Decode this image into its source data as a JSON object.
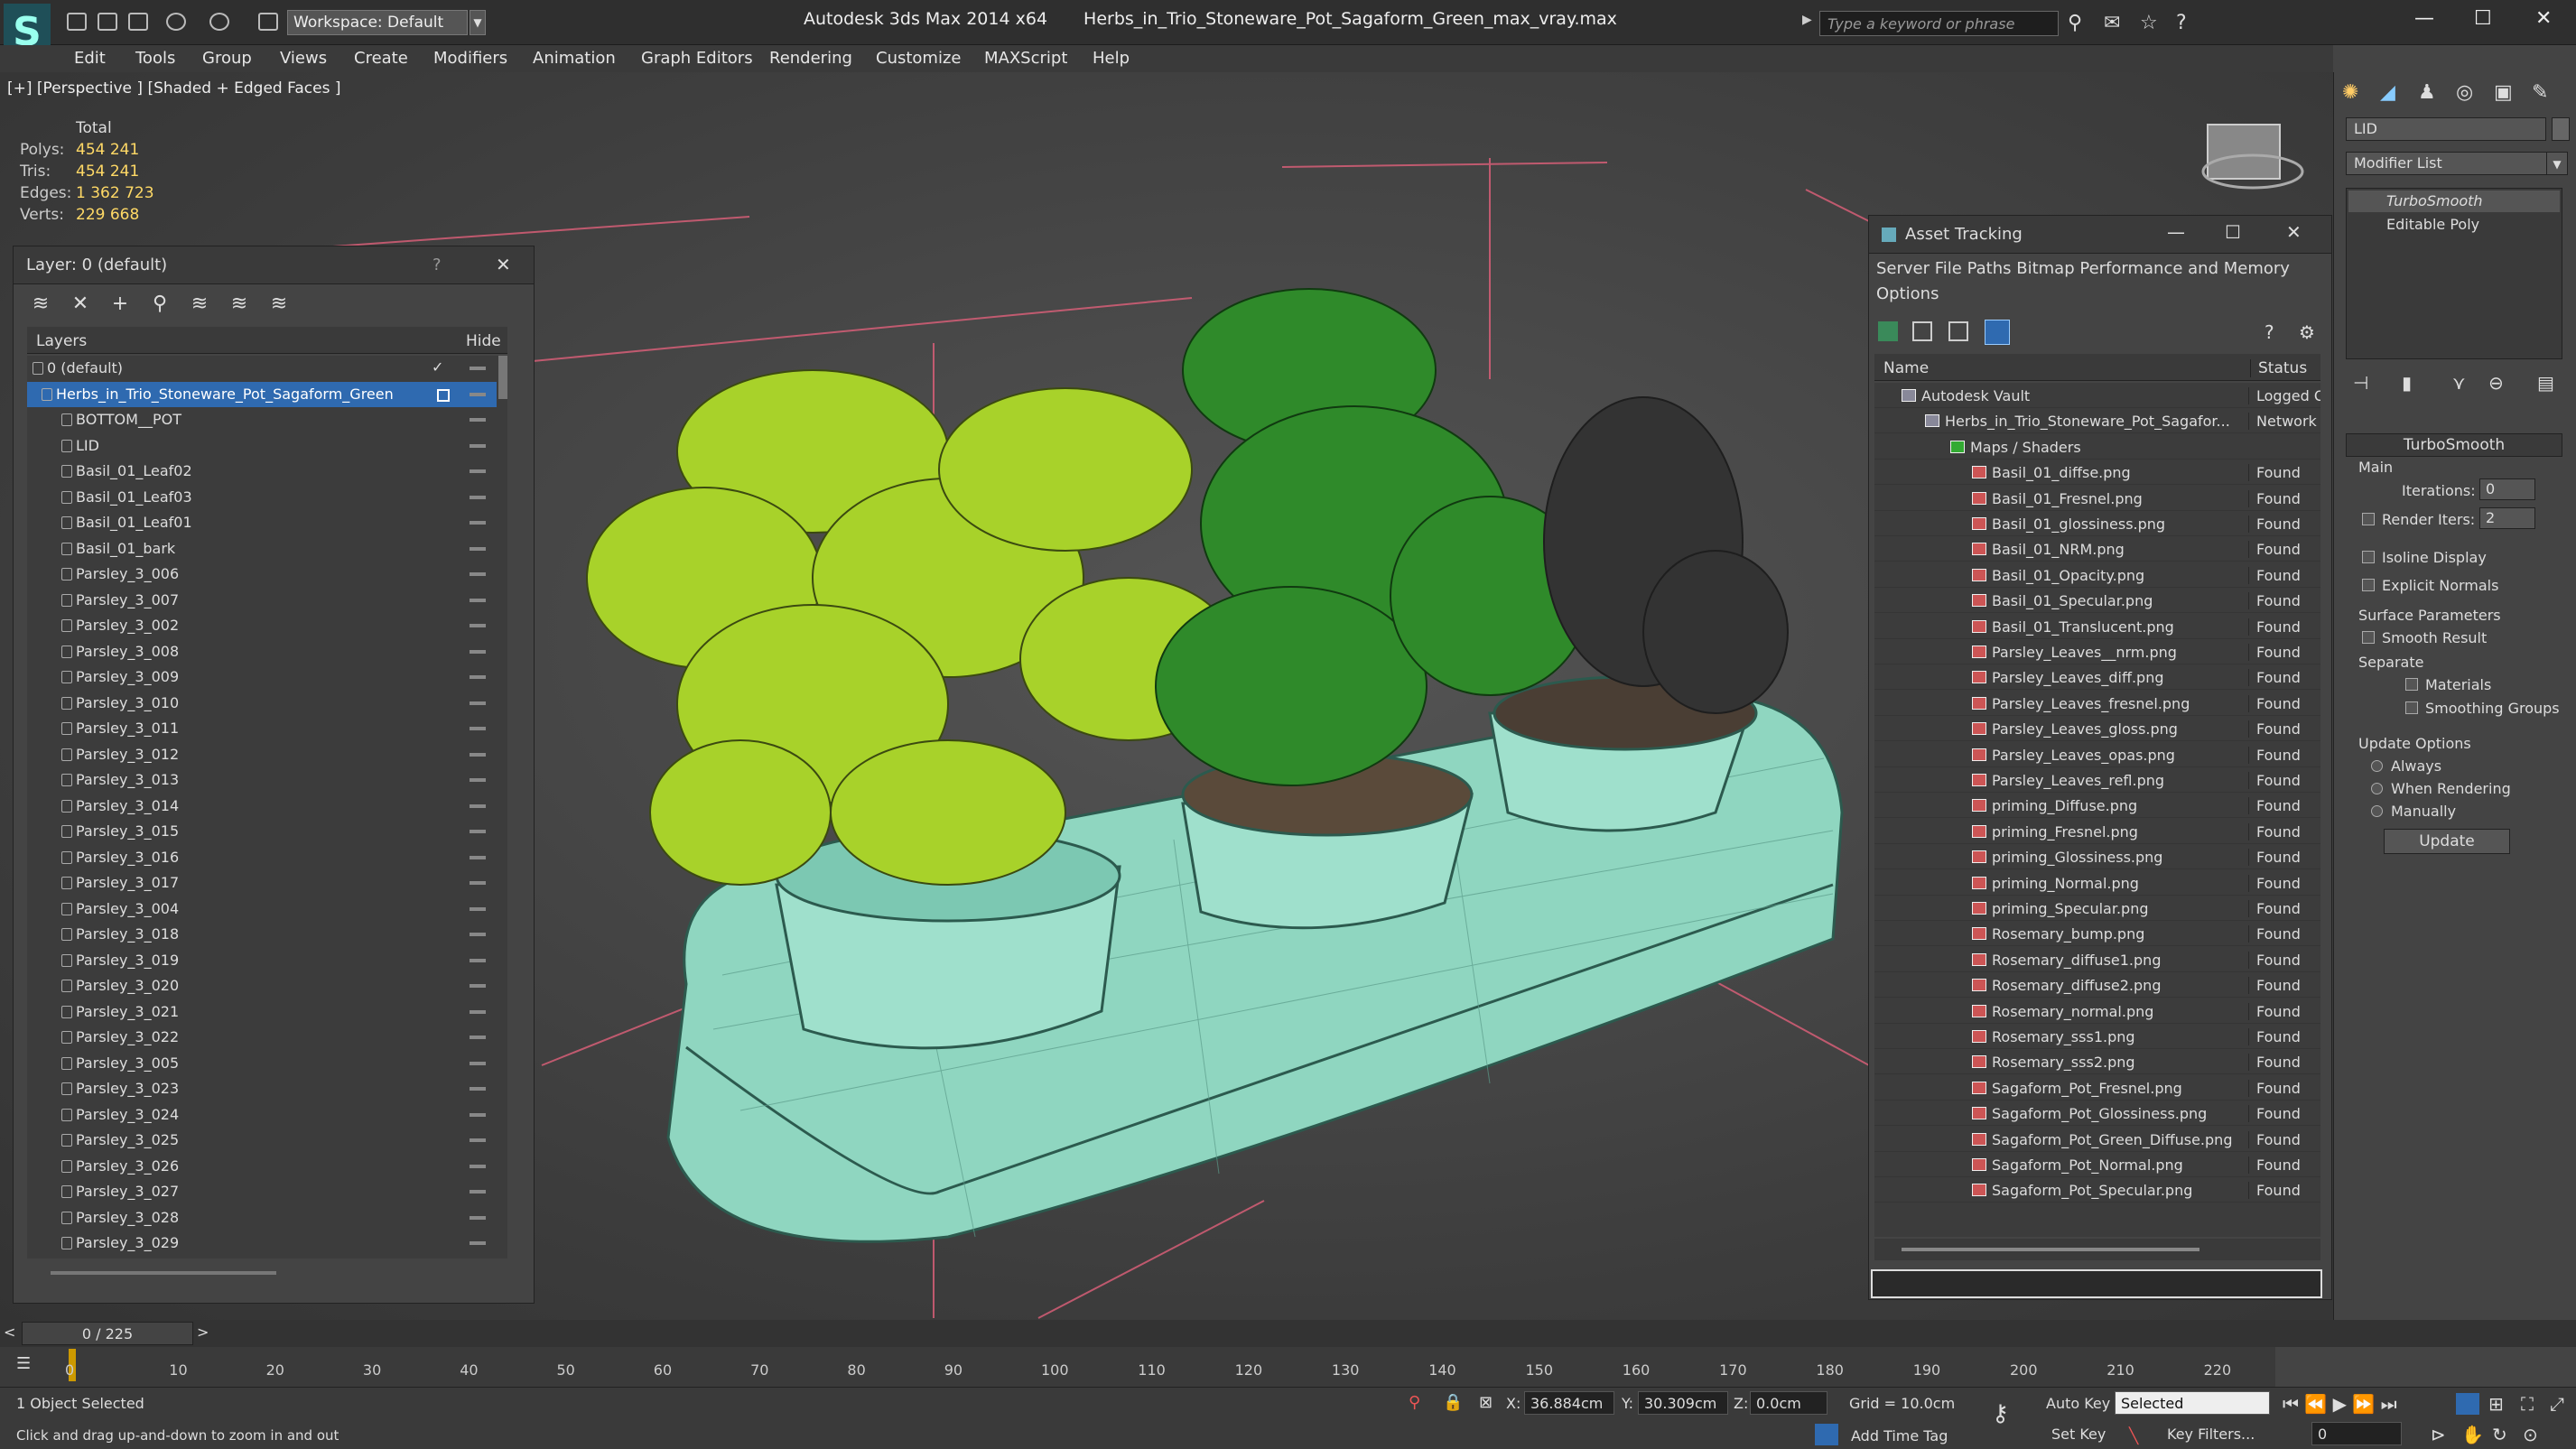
{
  "app": {
    "title": "Autodesk 3ds Max  2014 x64",
    "file": "Herbs_in_Trio_Stoneware_Pot_Sagaform_Green_max_vray.max",
    "workspace": "Workspace: Default",
    "search_placeholder": "Type a keyword or phrase",
    "logo": "S"
  },
  "menu": [
    "Edit",
    "Tools",
    "Group",
    "Views",
    "Create",
    "Modifiers",
    "Animation",
    "Graph Editors",
    "Rendering",
    "Customize",
    "MAXScript",
    "Help"
  ],
  "viewport": {
    "label": "[+] [Perspective ] [Shaded + Edged Faces ]",
    "stats_header": "Total",
    "stats": [
      {
        "k": "Polys:",
        "v": "454 241"
      },
      {
        "k": "Tris:",
        "v": "454 241"
      },
      {
        "k": "Edges:",
        "v": "1 362 723"
      },
      {
        "k": "Verts:",
        "v": "229 668"
      }
    ]
  },
  "layer_window": {
    "title": "Layer: 0 (default)",
    "help": "?",
    "col_layers": "Layers",
    "col_hide": "Hide",
    "rows": [
      "0 (default)",
      "Herbs_in_Trio_Stoneware_Pot_Sagaform_Green",
      "BOTTOM__POT",
      "LID",
      "Basil_01_Leaf02",
      "Basil_01_Leaf03",
      "Basil_01_Leaf01",
      "Basil_01_bark",
      "Parsley_3_006",
      "Parsley_3_007",
      "Parsley_3_002",
      "Parsley_3_008",
      "Parsley_3_009",
      "Parsley_3_010",
      "Parsley_3_011",
      "Parsley_3_012",
      "Parsley_3_013",
      "Parsley_3_014",
      "Parsley_3_015",
      "Parsley_3_016",
      "Parsley_3_017",
      "Parsley_3_004",
      "Parsley_3_018",
      "Parsley_3_019",
      "Parsley_3_020",
      "Parsley_3_021",
      "Parsley_3_022",
      "Parsley_3_005",
      "Parsley_3_023",
      "Parsley_3_024",
      "Parsley_3_025",
      "Parsley_3_026",
      "Parsley_3_027",
      "Parsley_3_028",
      "Parsley_3_029"
    ]
  },
  "asset_window": {
    "title": "Asset Tracking",
    "menu1": "Server   File   Paths   Bitmap Performance and Memory",
    "menu2": "Options",
    "col_name": "Name",
    "col_status": "Status",
    "rows": [
      {
        "name": "Autodesk Vault",
        "status": "Logged O",
        "lvl": 1
      },
      {
        "name": "Herbs_in_Trio_Stoneware_Pot_Sagafor...",
        "status": "Network P",
        "lvl": 2
      },
      {
        "name": "Maps / Shaders",
        "status": "",
        "lvl": 3
      },
      {
        "name": "Basil_01_diffse.png",
        "status": "Found",
        "lvl": 4
      },
      {
        "name": "Basil_01_Fresnel.png",
        "status": "Found",
        "lvl": 4
      },
      {
        "name": "Basil_01_glossiness.png",
        "status": "Found",
        "lvl": 4
      },
      {
        "name": "Basil_01_NRM.png",
        "status": "Found",
        "lvl": 4
      },
      {
        "name": "Basil_01_Opacity.png",
        "status": "Found",
        "lvl": 4
      },
      {
        "name": "Basil_01_Specular.png",
        "status": "Found",
        "lvl": 4
      },
      {
        "name": "Basil_01_Translucent.png",
        "status": "Found",
        "lvl": 4
      },
      {
        "name": "Parsley_Leaves__nrm.png",
        "status": "Found",
        "lvl": 4
      },
      {
        "name": "Parsley_Leaves_diff.png",
        "status": "Found",
        "lvl": 4
      },
      {
        "name": "Parsley_Leaves_fresnel.png",
        "status": "Found",
        "lvl": 4
      },
      {
        "name": "Parsley_Leaves_gloss.png",
        "status": "Found",
        "lvl": 4
      },
      {
        "name": "Parsley_Leaves_opas.png",
        "status": "Found",
        "lvl": 4
      },
      {
        "name": "Parsley_Leaves_refl.png",
        "status": "Found",
        "lvl": 4
      },
      {
        "name": "priming_Diffuse.png",
        "status": "Found",
        "lvl": 4
      },
      {
        "name": "priming_Fresnel.png",
        "status": "Found",
        "lvl": 4
      },
      {
        "name": "priming_Glossiness.png",
        "status": "Found",
        "lvl": 4
      },
      {
        "name": "priming_Normal.png",
        "status": "Found",
        "lvl": 4
      },
      {
        "name": "priming_Specular.png",
        "status": "Found",
        "lvl": 4
      },
      {
        "name": "Rosemary_bump.png",
        "status": "Found",
        "lvl": 4
      },
      {
        "name": "Rosemary_diffuse1.png",
        "status": "Found",
        "lvl": 4
      },
      {
        "name": "Rosemary_diffuse2.png",
        "status": "Found",
        "lvl": 4
      },
      {
        "name": "Rosemary_normal.png",
        "status": "Found",
        "lvl": 4
      },
      {
        "name": "Rosemary_sss1.png",
        "status": "Found",
        "lvl": 4
      },
      {
        "name": "Rosemary_sss2.png",
        "status": "Found",
        "lvl": 4
      },
      {
        "name": "Sagaform_Pot_Fresnel.png",
        "status": "Found",
        "lvl": 4
      },
      {
        "name": "Sagaform_Pot_Glossiness.png",
        "status": "Found",
        "lvl": 4
      },
      {
        "name": "Sagaform_Pot_Green_Diffuse.png",
        "status": "Found",
        "lvl": 4
      },
      {
        "name": "Sagaform_Pot_Normal.png",
        "status": "Found",
        "lvl": 4
      },
      {
        "name": "Sagaform_Pot_Specular.png",
        "status": "Found",
        "lvl": 4
      }
    ]
  },
  "command_panel": {
    "object_name": "LID",
    "modifier_list": "Modifier List",
    "stack": [
      "TurboSmooth",
      "Editable Poly"
    ],
    "rollout": "TurboSmooth",
    "main": "Main",
    "iterations_label": "Iterations:",
    "iterations": "0",
    "render_iters_label": "Render Iters:",
    "render_iters": "2",
    "isoline": "Isoline Display",
    "explicit": "Explicit Normals",
    "surface": "Surface Parameters",
    "smooth": "Smooth Result",
    "separate": "Separate",
    "materials": "Materials",
    "smoothing": "Smoothing Groups",
    "update_options": "Update Options",
    "always": "Always",
    "when_rendering": "When Rendering",
    "manually": "Manually",
    "update_btn": "Update"
  },
  "timeline": {
    "frame": "0 / 225",
    "ticks": [
      "0",
      "10",
      "20",
      "30",
      "40",
      "50",
      "60",
      "70",
      "80",
      "90",
      "100",
      "110",
      "120",
      "130",
      "140",
      "150",
      "160",
      "170",
      "180",
      "190",
      "200",
      "210",
      "220"
    ]
  },
  "status": {
    "selected": "1 Object Selected",
    "hint": "Click and drag up-and-down to zoom in and out",
    "x_label": "X:",
    "x": "36.884cm",
    "y_label": "Y:",
    "y": "30.309cm",
    "z_label": "Z:",
    "z": "0.0cm",
    "grid": "Grid = 10.0cm",
    "autokey": "Auto Key",
    "selected_set": "Selected",
    "setkey": "Set Key",
    "keyfilters": "Key Filters...",
    "addtimetag": "Add Time Tag",
    "frame_field": "0"
  },
  "colors": {
    "accent": "#2f6ab0",
    "stats": "#ffd966",
    "pot": "#8fd6c0",
    "leaves": "#a8d22a"
  }
}
